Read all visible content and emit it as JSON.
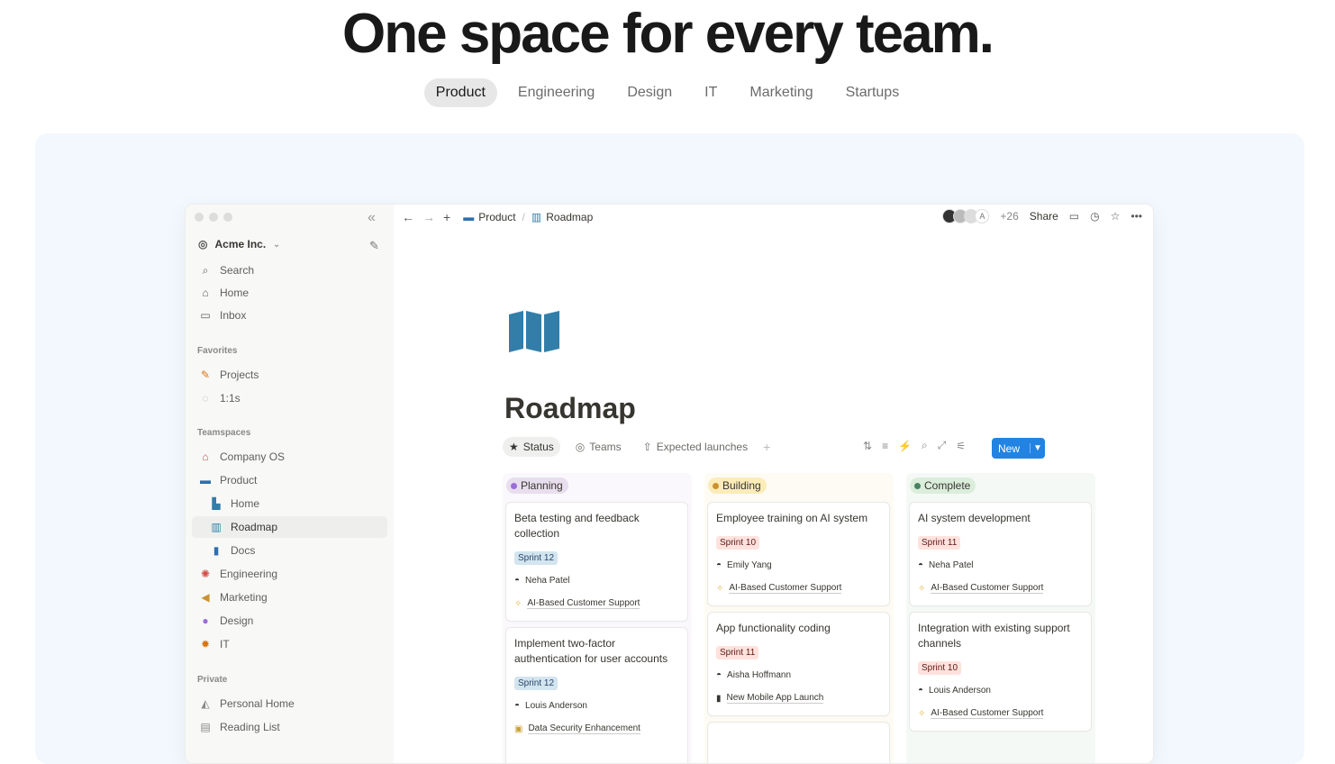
{
  "hero": {
    "title": "One space for every team."
  },
  "tabs": [
    "Product",
    "Engineering",
    "Design",
    "IT",
    "Marketing",
    "Startups"
  ],
  "sidebar": {
    "workspace": "Acme Inc.",
    "items": [
      {
        "icon": "search-icon",
        "label": "Search"
      },
      {
        "icon": "home-icon",
        "label": "Home"
      },
      {
        "icon": "inbox-icon",
        "label": "Inbox"
      }
    ],
    "favorites_heading": "Favorites",
    "favorites": [
      {
        "icon": "pencil-icon",
        "label": "Projects"
      },
      {
        "icon": "speech-bubble-icon",
        "label": "1:1s"
      }
    ],
    "teamspaces_heading": "Teamspaces",
    "teamspaces": [
      {
        "icon": "house-icon",
        "label": "Company OS",
        "sub": false
      },
      {
        "icon": "laptop-icon",
        "label": "Product",
        "sub": false
      },
      {
        "icon": "building-icon",
        "label": "Home",
        "sub": true
      },
      {
        "icon": "map-icon",
        "label": "Roadmap",
        "sub": true,
        "selected": true
      },
      {
        "icon": "bookmark-icon",
        "label": "Docs",
        "sub": true
      },
      {
        "icon": "gear-icon",
        "label": "Engineering",
        "sub": false
      },
      {
        "icon": "megaphone-icon",
        "label": "Marketing",
        "sub": false
      },
      {
        "icon": "palette-icon",
        "label": "Design",
        "sub": false
      },
      {
        "icon": "burst-icon",
        "label": "IT",
        "sub": false
      }
    ],
    "private_heading": "Private",
    "private": [
      {
        "icon": "user-home-icon",
        "label": "Personal Home"
      },
      {
        "icon": "book-icon",
        "label": "Reading List"
      }
    ]
  },
  "topbar": {
    "crumb1": "Product",
    "crumb2": "Roadmap",
    "avatar_letter": "A",
    "avatar_count": "+26",
    "share": "Share"
  },
  "page": {
    "title": "Roadmap",
    "views": [
      "Status",
      "Teams",
      "Expected launches"
    ],
    "new_label": "New"
  },
  "columns": [
    {
      "label": "Planning",
      "bg": "#faf8fc",
      "pill": "#e8deee",
      "dot": "#9a6dd7",
      "cards": [
        {
          "title": "Beta testing and feedback collection",
          "sprint": "Sprint 12",
          "person": "Neha Patel",
          "project": "AI-Based Customer Support",
          "project_icon": "sparkle-icon"
        },
        {
          "title": "Implement two-factor authentication for user accounts",
          "sprint": "Sprint 12",
          "person": "Louis Anderson",
          "project": "Data Security Enhancement",
          "project_icon": "lock-icon"
        }
      ]
    },
    {
      "label": "Building",
      "bg": "#fdfbf3",
      "pill": "#fbecb9",
      "dot": "#cb912f",
      "cards": [
        {
          "title": "Employee training on AI system",
          "sprint": "Sprint 10",
          "person": "Emily Yang",
          "project": "AI-Based Customer Support",
          "project_icon": "sparkle-icon"
        },
        {
          "title": "App functionality coding",
          "sprint": "Sprint 11",
          "person": "Aisha Hoffmann",
          "project": "New Mobile App Launch",
          "project_icon": "phone-icon"
        }
      ]
    },
    {
      "label": "Complete",
      "bg": "#f5f9f6",
      "pill": "#dbeddb",
      "dot": "#448361",
      "cards": [
        {
          "title": "AI system development",
          "sprint": "Sprint 11",
          "person": "Neha Patel",
          "project": "AI-Based Customer Support",
          "project_icon": "sparkle-icon"
        },
        {
          "title": "Integration with existing support channels",
          "sprint": "Sprint 10",
          "person": "Louis Anderson",
          "project": "AI-Based Customer Support",
          "project_icon": "sparkle-icon"
        }
      ]
    }
  ]
}
